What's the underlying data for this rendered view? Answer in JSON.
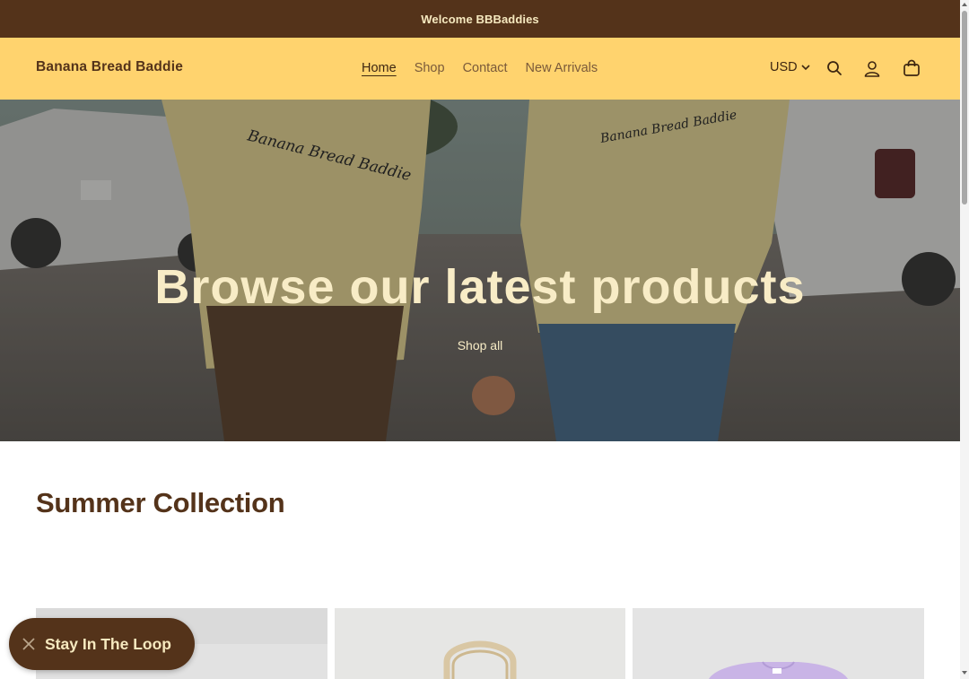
{
  "announcement": {
    "text": "Welcome BBBaddies"
  },
  "header": {
    "brand": "Banana Bread Baddie",
    "nav": [
      {
        "label": "Home",
        "active": true
      },
      {
        "label": "Shop",
        "active": false
      },
      {
        "label": "Contact",
        "active": false
      },
      {
        "label": "New Arrivals",
        "active": false
      }
    ],
    "currency": "USD",
    "icons": [
      "search-icon",
      "account-icon",
      "cart-icon"
    ]
  },
  "hero": {
    "title": "Browse our latest products",
    "link_label": "Shop all",
    "shirt_print": "Banana Bread Baddie"
  },
  "collection": {
    "title": "Summer Collection",
    "products": [
      {
        "image": "product-image"
      },
      {
        "image": "tote-bag-image"
      },
      {
        "image": "sweatshirt-image"
      }
    ]
  },
  "floating_button": {
    "label": "Stay In The Loop",
    "icon": "close-icon"
  },
  "colors": {
    "brown": "#54331a",
    "yellow": "#ffd36e",
    "cream": "#f8ecc6"
  }
}
